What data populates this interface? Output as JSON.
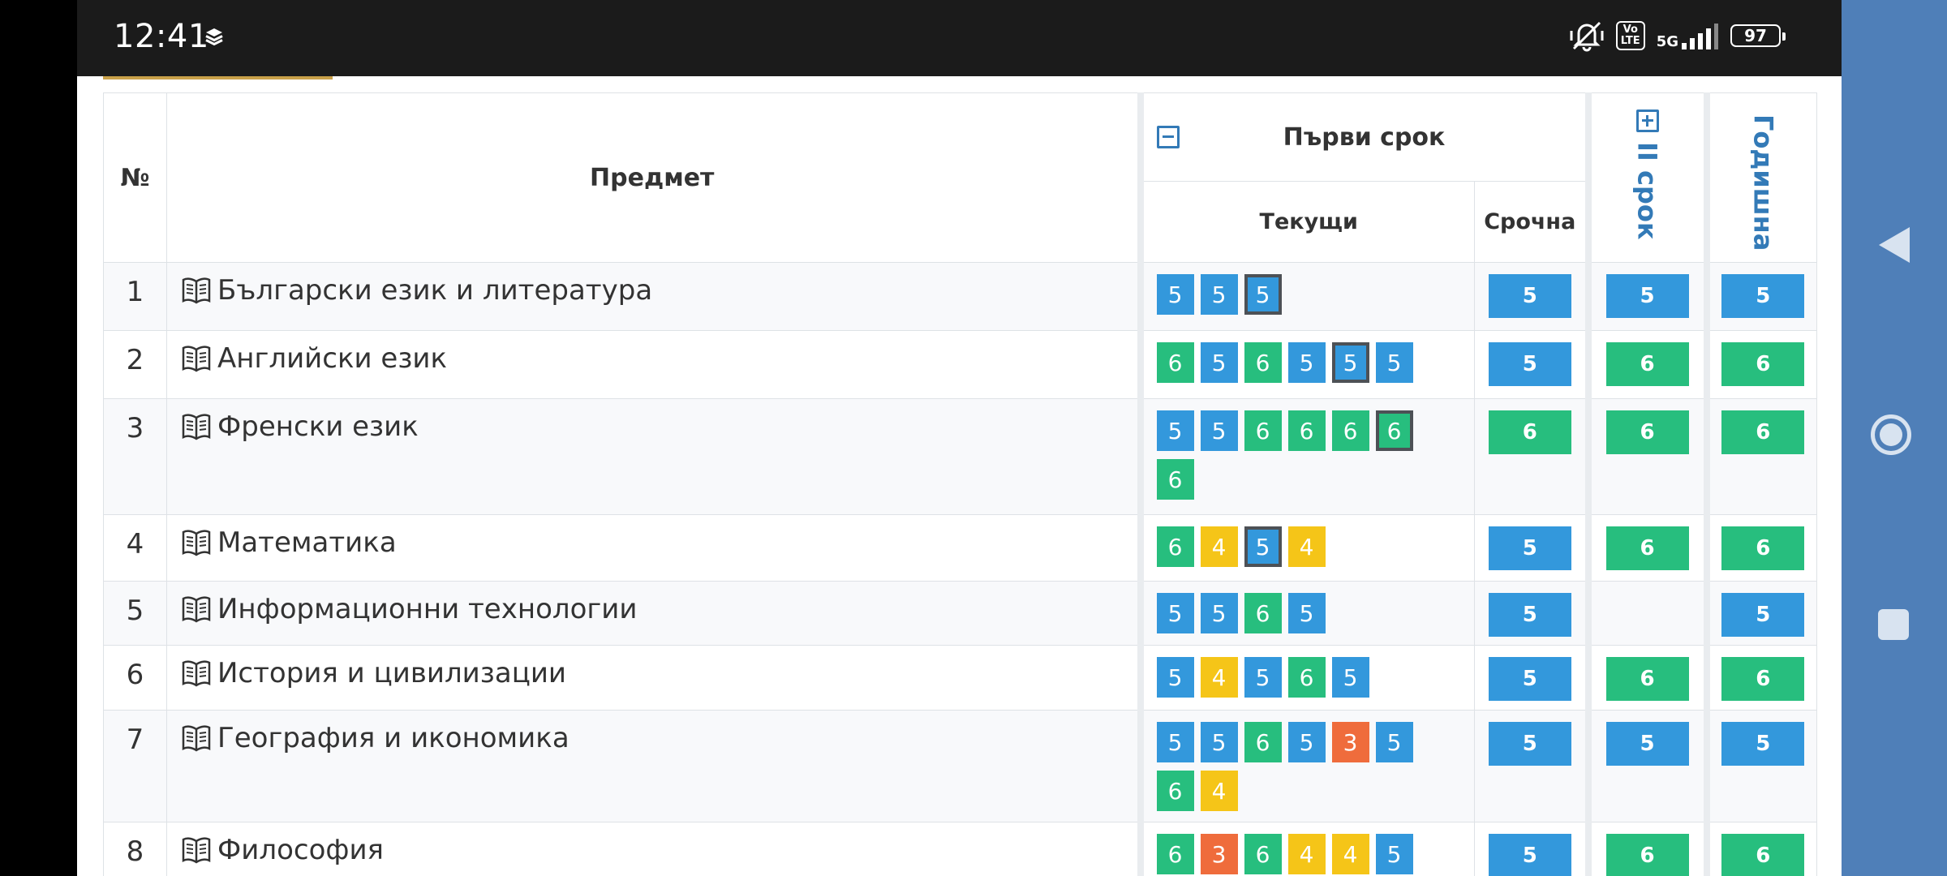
{
  "status_bar": {
    "time": "12:41",
    "volte_label": "Vo\nLTE",
    "network_label": "5G",
    "battery": "97"
  },
  "table": {
    "headers": {
      "number": "№",
      "subject": "Предмет",
      "first_term": "Първи срок",
      "current": "Текущи",
      "term_grade": "Срочна",
      "second_term": "II срок",
      "annual": "Годишна"
    },
    "rows": [
      {
        "num": "1",
        "subject": "Български език и литература",
        "grades": [
          {
            "v": "5",
            "c": "g5"
          },
          {
            "v": "5",
            "c": "g5"
          },
          {
            "v": "5",
            "c": "g5",
            "f": true
          }
        ],
        "term": {
          "v": "5",
          "c": "g5"
        },
        "second": {
          "v": "5",
          "c": "g5"
        },
        "annual": {
          "v": "5",
          "c": "g5"
        }
      },
      {
        "num": "2",
        "subject": "Английски език",
        "grades": [
          {
            "v": "6",
            "c": "g6"
          },
          {
            "v": "5",
            "c": "g5"
          },
          {
            "v": "6",
            "c": "g6"
          },
          {
            "v": "5",
            "c": "g5"
          },
          {
            "v": "5",
            "c": "g5",
            "f": true
          },
          {
            "v": "5",
            "c": "g5"
          }
        ],
        "term": {
          "v": "5",
          "c": "g5"
        },
        "second": {
          "v": "6",
          "c": "g6"
        },
        "annual": {
          "v": "6",
          "c": "g6"
        }
      },
      {
        "num": "3",
        "subject": "Френски език",
        "grades": [
          {
            "v": "5",
            "c": "g5"
          },
          {
            "v": "5",
            "c": "g5"
          },
          {
            "v": "6",
            "c": "g6"
          },
          {
            "v": "6",
            "c": "g6"
          },
          {
            "v": "6",
            "c": "g6"
          },
          {
            "v": "6",
            "c": "g6",
            "f": true
          },
          {
            "v": "6",
            "c": "g6"
          }
        ],
        "term": {
          "v": "6",
          "c": "g6"
        },
        "second": {
          "v": "6",
          "c": "g6"
        },
        "annual": {
          "v": "6",
          "c": "g6"
        }
      },
      {
        "num": "4",
        "subject": "Математика",
        "grades": [
          {
            "v": "6",
            "c": "g6"
          },
          {
            "v": "4",
            "c": "g4"
          },
          {
            "v": "5",
            "c": "g5",
            "f": true
          },
          {
            "v": "4",
            "c": "g4"
          }
        ],
        "term": {
          "v": "5",
          "c": "g5"
        },
        "second": {
          "v": "6",
          "c": "g6"
        },
        "annual": {
          "v": "6",
          "c": "g6"
        }
      },
      {
        "num": "5",
        "subject": "Информационни технологии",
        "grades": [
          {
            "v": "5",
            "c": "g5"
          },
          {
            "v": "5",
            "c": "g5"
          },
          {
            "v": "6",
            "c": "g6"
          },
          {
            "v": "5",
            "c": "g5"
          }
        ],
        "term": {
          "v": "5",
          "c": "g5"
        },
        "second": null,
        "annual": {
          "v": "5",
          "c": "g5"
        }
      },
      {
        "num": "6",
        "subject": "История и цивилизации",
        "grades": [
          {
            "v": "5",
            "c": "g5"
          },
          {
            "v": "4",
            "c": "g4"
          },
          {
            "v": "5",
            "c": "g5"
          },
          {
            "v": "6",
            "c": "g6"
          },
          {
            "v": "5",
            "c": "g5"
          }
        ],
        "term": {
          "v": "5",
          "c": "g5"
        },
        "second": {
          "v": "6",
          "c": "g6"
        },
        "annual": {
          "v": "6",
          "c": "g6"
        }
      },
      {
        "num": "7",
        "subject": "География и икономика",
        "grades": [
          {
            "v": "5",
            "c": "g5"
          },
          {
            "v": "5",
            "c": "g5"
          },
          {
            "v": "6",
            "c": "g6"
          },
          {
            "v": "5",
            "c": "g5"
          },
          {
            "v": "3",
            "c": "g3"
          },
          {
            "v": "5",
            "c": "g5"
          },
          {
            "v": "6",
            "c": "g6"
          },
          {
            "v": "4",
            "c": "g4"
          }
        ],
        "term": {
          "v": "5",
          "c": "g5"
        },
        "second": {
          "v": "5",
          "c": "g5"
        },
        "annual": {
          "v": "5",
          "c": "g5"
        }
      },
      {
        "num": "8",
        "subject": "Философия",
        "grades": [
          {
            "v": "6",
            "c": "g6"
          },
          {
            "v": "3",
            "c": "g3"
          },
          {
            "v": "6",
            "c": "g6"
          },
          {
            "v": "4",
            "c": "g4"
          },
          {
            "v": "4",
            "c": "g4"
          },
          {
            "v": "5",
            "c": "g5"
          }
        ],
        "term": {
          "v": "5",
          "c": "g5"
        },
        "second": {
          "v": "6",
          "c": "g6"
        },
        "annual": {
          "v": "6",
          "c": "g6"
        }
      }
    ]
  },
  "colors": {
    "grade_6": "#27be7e",
    "grade_5": "#3398dc",
    "grade_4": "#f5c518",
    "grade_3": "#ef6c3c",
    "header_accent": "#337ab7",
    "nav_bar": "#4f7fb8"
  },
  "icons": {
    "status": [
      "layers-icon",
      "mute-vibrate-icon",
      "volte-icon",
      "signal-icon",
      "battery-icon"
    ],
    "subject": "open-book-icon",
    "collapse_first_term": "minus-square-icon",
    "expand_second_term": "plus-square-icon",
    "navigation": [
      "back-icon",
      "home-icon",
      "recents-icon"
    ]
  }
}
